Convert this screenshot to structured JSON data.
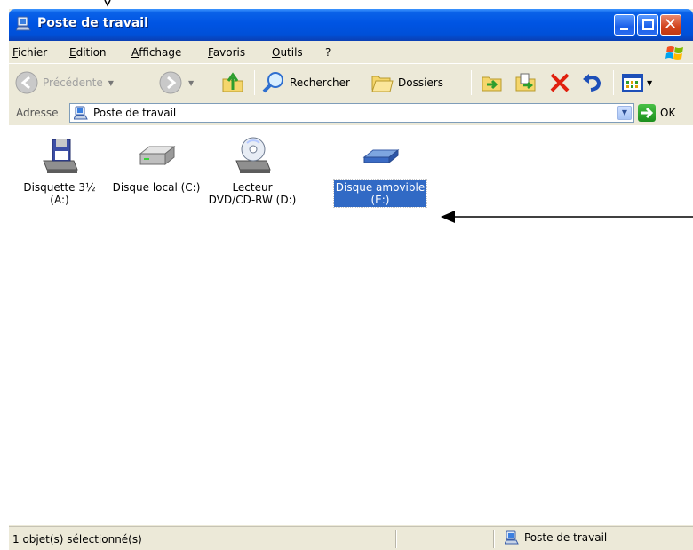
{
  "window": {
    "title": "Poste de travail",
    "accent": "#0054e3"
  },
  "menu": {
    "items": [
      "Fichier",
      "Edition",
      "Affichage",
      "Favoris",
      "Outils",
      "?"
    ]
  },
  "toolbar": {
    "back_label": "Précédente",
    "search_label": "Rechercher",
    "folders_label": "Dossiers"
  },
  "address": {
    "label": "Adresse",
    "value": "Poste de travail",
    "go_label": "OK"
  },
  "drives": [
    {
      "label_line1": "Disquette 3½",
      "label_line2": "(A:)",
      "icon": "floppy-drive-icon",
      "selected": false
    },
    {
      "label_line1": "Disque local (C:)",
      "label_line2": "",
      "icon": "hard-disk-icon",
      "selected": false
    },
    {
      "label_line1": "Lecteur",
      "label_line2": "DVD/CD-RW (D:)",
      "icon": "cd-drive-icon",
      "selected": false
    },
    {
      "label_line1": "Disque amovible",
      "label_line2": "(E:)",
      "icon": "removable-disk-icon",
      "selected": true
    }
  ],
  "status": {
    "left": "1 objet(s) sélectionné(s)",
    "right": "Poste de travail"
  },
  "colors": {
    "selection": "#316ac5",
    "window_bg": "#ece9d8"
  }
}
